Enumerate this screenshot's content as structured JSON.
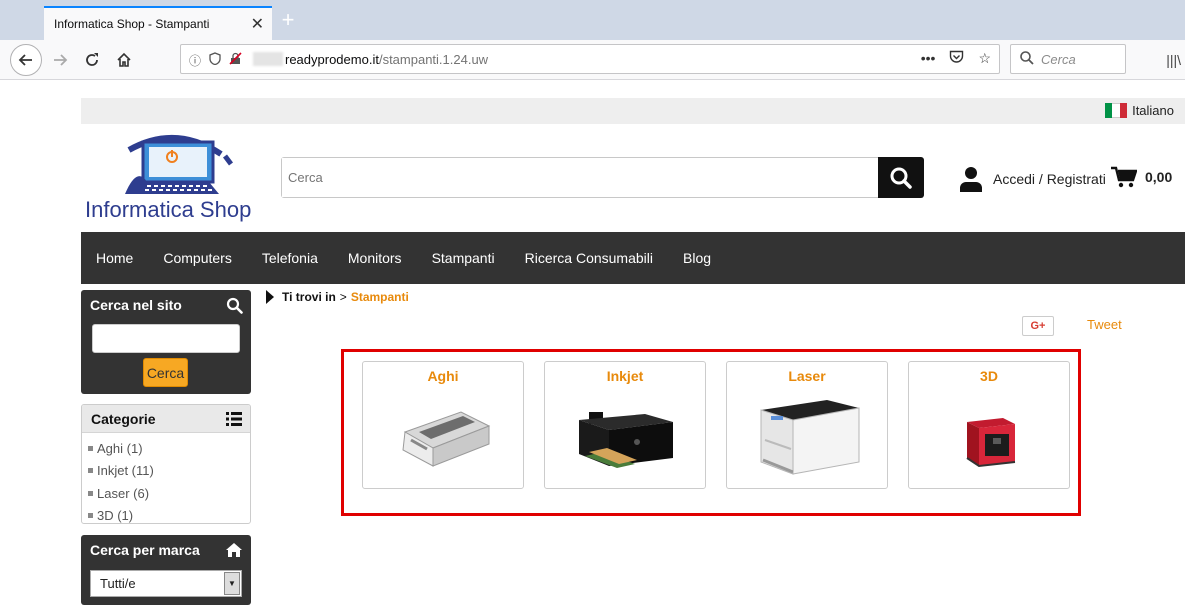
{
  "browser": {
    "tab_title": "Informatica Shop - Stampanti",
    "tab_close": "✕",
    "new_tab": "+",
    "url_host": "readyprodemo.it",
    "url_path": "/stampanti.1.24.uw",
    "search_placeholder": "Cerca"
  },
  "header": {
    "language": "Italiano",
    "logo_text": "Informatica Shop",
    "search_placeholder": "Cerca",
    "account_label": "Accedi / Registrati",
    "cart_total": "0,00"
  },
  "menu": {
    "items": [
      "Home",
      "Computers",
      "Telefonia",
      "Monitors",
      "Stampanti",
      "Ricerca Consumabili",
      "Blog"
    ],
    "active": "Stampanti"
  },
  "sidebar": {
    "search_title": "Cerca nel sito",
    "search_button": "Cerca",
    "categories_title": "Categorie",
    "categories": [
      "Aghi (1)",
      "Inkjet (11)",
      "Laser (6)",
      "3D (1)"
    ],
    "brand_title": "Cerca per marca",
    "brand_selected": "Tutti/e"
  },
  "breadcrumb": {
    "label": "Ti trovi in",
    "separator": ">",
    "current": "Stampanti"
  },
  "social": {
    "gplus": "G+",
    "tweet": "Tweet"
  },
  "categories_grid": {
    "cards": [
      {
        "title": "Aghi",
        "icon": "dot-matrix-printer-icon"
      },
      {
        "title": "Inkjet",
        "icon": "inkjet-printer-icon"
      },
      {
        "title": "Laser",
        "icon": "laser-printer-icon"
      },
      {
        "title": "3D",
        "icon": "3d-printer-icon"
      }
    ]
  },
  "colors": {
    "accent": "#e88a0c",
    "menu_bg": "#333333",
    "highlight": "#e00000",
    "logo_blue": "#2e3d8f"
  }
}
